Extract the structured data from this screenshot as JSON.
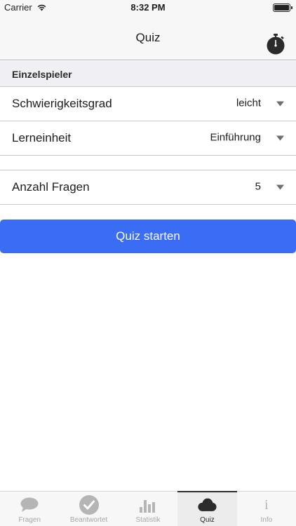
{
  "status_bar": {
    "carrier": "Carrier",
    "time": "8:32 PM",
    "battery_level": 1.0,
    "wifi_icon": "wifi-icon",
    "battery_icon": "battery-icon"
  },
  "nav": {
    "title": "Quiz",
    "timer_icon": "stopwatch-icon"
  },
  "section": {
    "header": "Einzelspieler"
  },
  "settings": {
    "difficulty": {
      "label": "Schwierigkeitsgrad",
      "value": "leicht"
    },
    "unit": {
      "label": "Lerneinheit",
      "value": "Einführung"
    },
    "question_count": {
      "label": "Anzahl Fragen",
      "value": "5"
    }
  },
  "start_button": {
    "label": "Quiz starten"
  },
  "tab_bar": {
    "active_tab": "Quiz",
    "tabs": [
      {
        "label": "Fragen",
        "icon": "speech-bubble-icon"
      },
      {
        "label": "Beantwortet",
        "icon": "checkmark-circle-icon"
      },
      {
        "label": "Statistik",
        "icon": "bar-chart-icon"
      },
      {
        "label": "Quiz",
        "icon": "cloud-icon"
      },
      {
        "label": "Info",
        "icon": "info-icon"
      }
    ]
  },
  "colors": {
    "accent": "#3a6cf4",
    "bar_background": "#f7f7f7",
    "section_background": "#efeff4",
    "separator": "#c8c7cc",
    "tab_inactive": "#a7a7a7"
  }
}
